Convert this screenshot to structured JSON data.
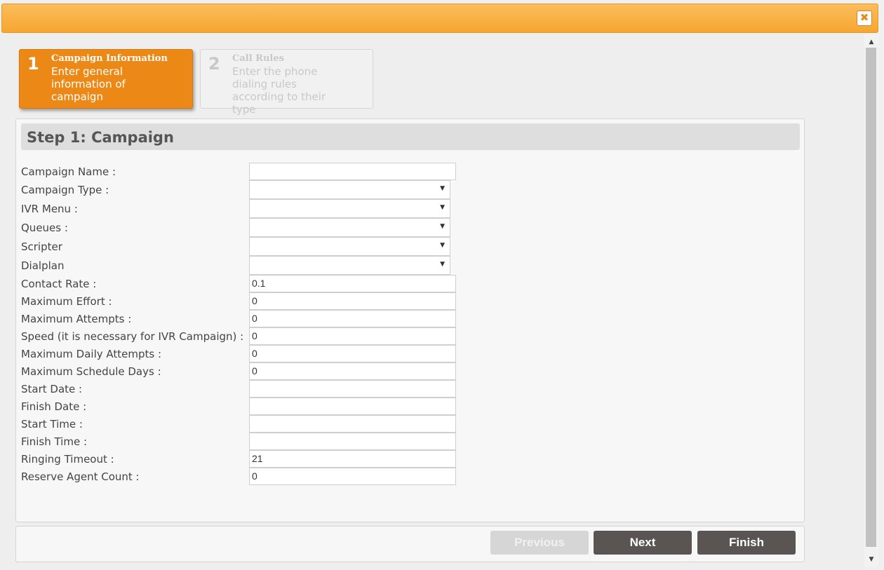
{
  "window": {
    "close_glyph": "✖"
  },
  "steps": [
    {
      "number": "1",
      "title": "Campaign Information",
      "description": "Enter general information of campaign",
      "state": "active"
    },
    {
      "number": "2",
      "title": "Call Rules",
      "description": "Enter the phone dialing rules according to their type",
      "state": "inactive"
    }
  ],
  "panel": {
    "title": "Step 1: Campaign"
  },
  "form": {
    "campaign_name": {
      "label": "Campaign Name :",
      "value": ""
    },
    "campaign_type": {
      "label": "Campaign Type :",
      "value": ""
    },
    "ivr_menu": {
      "label": "IVR Menu :",
      "value": ""
    },
    "queues": {
      "label": "Queues :",
      "value": ""
    },
    "scripter": {
      "label": "Scripter",
      "value": ""
    },
    "dialplan": {
      "label": "Dialplan",
      "value": ""
    },
    "contact_rate": {
      "label": "Contact Rate :",
      "value": "0.1"
    },
    "maximum_effort": {
      "label": "Maximum Effort :",
      "value": "0"
    },
    "maximum_attempts": {
      "label": "Maximum Attempts :",
      "value": "0"
    },
    "speed": {
      "label": "Speed (it is necessary for IVR Campaign) :",
      "value": "0"
    },
    "maximum_daily_attempts": {
      "label": "Maximum Daily Attempts :",
      "value": "0"
    },
    "maximum_schedule_days": {
      "label": "Maximum Schedule Days :",
      "value": "0"
    },
    "start_date": {
      "label": "Start Date :",
      "value": ""
    },
    "finish_date": {
      "label": "Finish Date :",
      "value": ""
    },
    "start_time": {
      "label": "Start Time :",
      "value": ""
    },
    "finish_time": {
      "label": "Finish Time :",
      "value": ""
    },
    "ringing_timeout": {
      "label": "Ringing Timeout :",
      "value": "21"
    },
    "reserve_agent_count": {
      "label": "Reserve Agent Count :",
      "value": "0"
    }
  },
  "select_arrow": "▼",
  "buttons": {
    "previous": "Previous",
    "next": "Next",
    "finish": "Finish"
  },
  "colors": {
    "titlebar": "#f6a630",
    "active_step": "#ec8916",
    "button_dark": "#5a5453",
    "button_disabled": "#d6d6d6"
  }
}
